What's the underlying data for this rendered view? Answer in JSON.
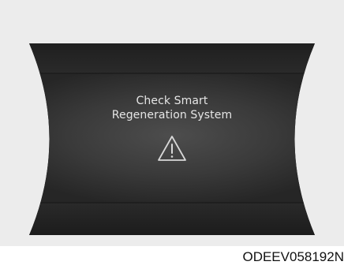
{
  "display": {
    "message_line1": "Check Smart",
    "message_line2": "Regeneration System",
    "icon": "warning-triangle-icon"
  },
  "figure_code": "ODEEV058192N",
  "colors": {
    "background": "#ececec",
    "display_dark": "#1c1c1c",
    "display_center": "#4a4a4a",
    "text": "#e6e6e6"
  }
}
